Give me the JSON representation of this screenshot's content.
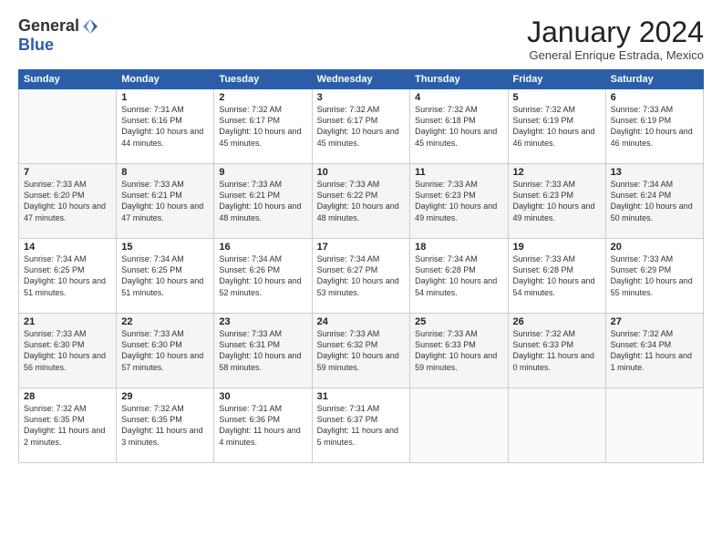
{
  "logo": {
    "general": "General",
    "blue": "Blue"
  },
  "title": "January 2024",
  "location": "General Enrique Estrada, Mexico",
  "days_header": [
    "Sunday",
    "Monday",
    "Tuesday",
    "Wednesday",
    "Thursday",
    "Friday",
    "Saturday"
  ],
  "weeks": [
    [
      {
        "num": "",
        "sunrise": "",
        "sunset": "",
        "daylight": ""
      },
      {
        "num": "1",
        "sunrise": "Sunrise: 7:31 AM",
        "sunset": "Sunset: 6:16 PM",
        "daylight": "Daylight: 10 hours and 44 minutes."
      },
      {
        "num": "2",
        "sunrise": "Sunrise: 7:32 AM",
        "sunset": "Sunset: 6:17 PM",
        "daylight": "Daylight: 10 hours and 45 minutes."
      },
      {
        "num": "3",
        "sunrise": "Sunrise: 7:32 AM",
        "sunset": "Sunset: 6:17 PM",
        "daylight": "Daylight: 10 hours and 45 minutes."
      },
      {
        "num": "4",
        "sunrise": "Sunrise: 7:32 AM",
        "sunset": "Sunset: 6:18 PM",
        "daylight": "Daylight: 10 hours and 45 minutes."
      },
      {
        "num": "5",
        "sunrise": "Sunrise: 7:32 AM",
        "sunset": "Sunset: 6:19 PM",
        "daylight": "Daylight: 10 hours and 46 minutes."
      },
      {
        "num": "6",
        "sunrise": "Sunrise: 7:33 AM",
        "sunset": "Sunset: 6:19 PM",
        "daylight": "Daylight: 10 hours and 46 minutes."
      }
    ],
    [
      {
        "num": "7",
        "sunrise": "Sunrise: 7:33 AM",
        "sunset": "Sunset: 6:20 PM",
        "daylight": "Daylight: 10 hours and 47 minutes."
      },
      {
        "num": "8",
        "sunrise": "Sunrise: 7:33 AM",
        "sunset": "Sunset: 6:21 PM",
        "daylight": "Daylight: 10 hours and 47 minutes."
      },
      {
        "num": "9",
        "sunrise": "Sunrise: 7:33 AM",
        "sunset": "Sunset: 6:21 PM",
        "daylight": "Daylight: 10 hours and 48 minutes."
      },
      {
        "num": "10",
        "sunrise": "Sunrise: 7:33 AM",
        "sunset": "Sunset: 6:22 PM",
        "daylight": "Daylight: 10 hours and 48 minutes."
      },
      {
        "num": "11",
        "sunrise": "Sunrise: 7:33 AM",
        "sunset": "Sunset: 6:23 PM",
        "daylight": "Daylight: 10 hours and 49 minutes."
      },
      {
        "num": "12",
        "sunrise": "Sunrise: 7:33 AM",
        "sunset": "Sunset: 6:23 PM",
        "daylight": "Daylight: 10 hours and 49 minutes."
      },
      {
        "num": "13",
        "sunrise": "Sunrise: 7:34 AM",
        "sunset": "Sunset: 6:24 PM",
        "daylight": "Daylight: 10 hours and 50 minutes."
      }
    ],
    [
      {
        "num": "14",
        "sunrise": "Sunrise: 7:34 AM",
        "sunset": "Sunset: 6:25 PM",
        "daylight": "Daylight: 10 hours and 51 minutes."
      },
      {
        "num": "15",
        "sunrise": "Sunrise: 7:34 AM",
        "sunset": "Sunset: 6:25 PM",
        "daylight": "Daylight: 10 hours and 51 minutes."
      },
      {
        "num": "16",
        "sunrise": "Sunrise: 7:34 AM",
        "sunset": "Sunset: 6:26 PM",
        "daylight": "Daylight: 10 hours and 52 minutes."
      },
      {
        "num": "17",
        "sunrise": "Sunrise: 7:34 AM",
        "sunset": "Sunset: 6:27 PM",
        "daylight": "Daylight: 10 hours and 53 minutes."
      },
      {
        "num": "18",
        "sunrise": "Sunrise: 7:34 AM",
        "sunset": "Sunset: 6:28 PM",
        "daylight": "Daylight: 10 hours and 54 minutes."
      },
      {
        "num": "19",
        "sunrise": "Sunrise: 7:33 AM",
        "sunset": "Sunset: 6:28 PM",
        "daylight": "Daylight: 10 hours and 54 minutes."
      },
      {
        "num": "20",
        "sunrise": "Sunrise: 7:33 AM",
        "sunset": "Sunset: 6:29 PM",
        "daylight": "Daylight: 10 hours and 55 minutes."
      }
    ],
    [
      {
        "num": "21",
        "sunrise": "Sunrise: 7:33 AM",
        "sunset": "Sunset: 6:30 PM",
        "daylight": "Daylight: 10 hours and 56 minutes."
      },
      {
        "num": "22",
        "sunrise": "Sunrise: 7:33 AM",
        "sunset": "Sunset: 6:30 PM",
        "daylight": "Daylight: 10 hours and 57 minutes."
      },
      {
        "num": "23",
        "sunrise": "Sunrise: 7:33 AM",
        "sunset": "Sunset: 6:31 PM",
        "daylight": "Daylight: 10 hours and 58 minutes."
      },
      {
        "num": "24",
        "sunrise": "Sunrise: 7:33 AM",
        "sunset": "Sunset: 6:32 PM",
        "daylight": "Daylight: 10 hours and 59 minutes."
      },
      {
        "num": "25",
        "sunrise": "Sunrise: 7:33 AM",
        "sunset": "Sunset: 6:33 PM",
        "daylight": "Daylight: 10 hours and 59 minutes."
      },
      {
        "num": "26",
        "sunrise": "Sunrise: 7:32 AM",
        "sunset": "Sunset: 6:33 PM",
        "daylight": "Daylight: 11 hours and 0 minutes."
      },
      {
        "num": "27",
        "sunrise": "Sunrise: 7:32 AM",
        "sunset": "Sunset: 6:34 PM",
        "daylight": "Daylight: 11 hours and 1 minute."
      }
    ],
    [
      {
        "num": "28",
        "sunrise": "Sunrise: 7:32 AM",
        "sunset": "Sunset: 6:35 PM",
        "daylight": "Daylight: 11 hours and 2 minutes."
      },
      {
        "num": "29",
        "sunrise": "Sunrise: 7:32 AM",
        "sunset": "Sunset: 6:35 PM",
        "daylight": "Daylight: 11 hours and 3 minutes."
      },
      {
        "num": "30",
        "sunrise": "Sunrise: 7:31 AM",
        "sunset": "Sunset: 6:36 PM",
        "daylight": "Daylight: 11 hours and 4 minutes."
      },
      {
        "num": "31",
        "sunrise": "Sunrise: 7:31 AM",
        "sunset": "Sunset: 6:37 PM",
        "daylight": "Daylight: 11 hours and 5 minutes."
      },
      {
        "num": "",
        "sunrise": "",
        "sunset": "",
        "daylight": ""
      },
      {
        "num": "",
        "sunrise": "",
        "sunset": "",
        "daylight": ""
      },
      {
        "num": "",
        "sunrise": "",
        "sunset": "",
        "daylight": ""
      }
    ]
  ]
}
